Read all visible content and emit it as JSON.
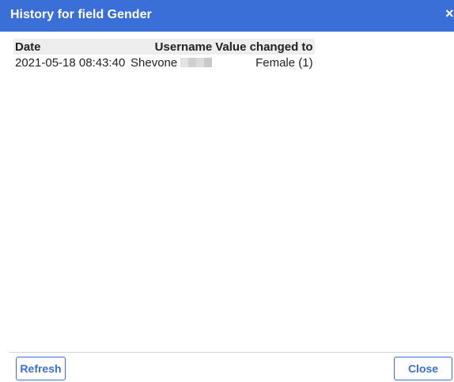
{
  "dialog": {
    "title": "History for field Gender",
    "close_glyph": "×"
  },
  "table": {
    "headers": {
      "date": "Date",
      "username": "Username",
      "value": "Value changed to"
    },
    "rows": [
      {
        "date": "2021-05-18 08:43:40",
        "username": "Shevone",
        "value": "Female (1)"
      }
    ]
  },
  "footer": {
    "refresh_label": "Refresh",
    "close_label": "Close"
  },
  "colors": {
    "accent": "#3a6fd8",
    "header_bg": "#eeeeee"
  },
  "icons": {
    "close": "close-icon"
  }
}
